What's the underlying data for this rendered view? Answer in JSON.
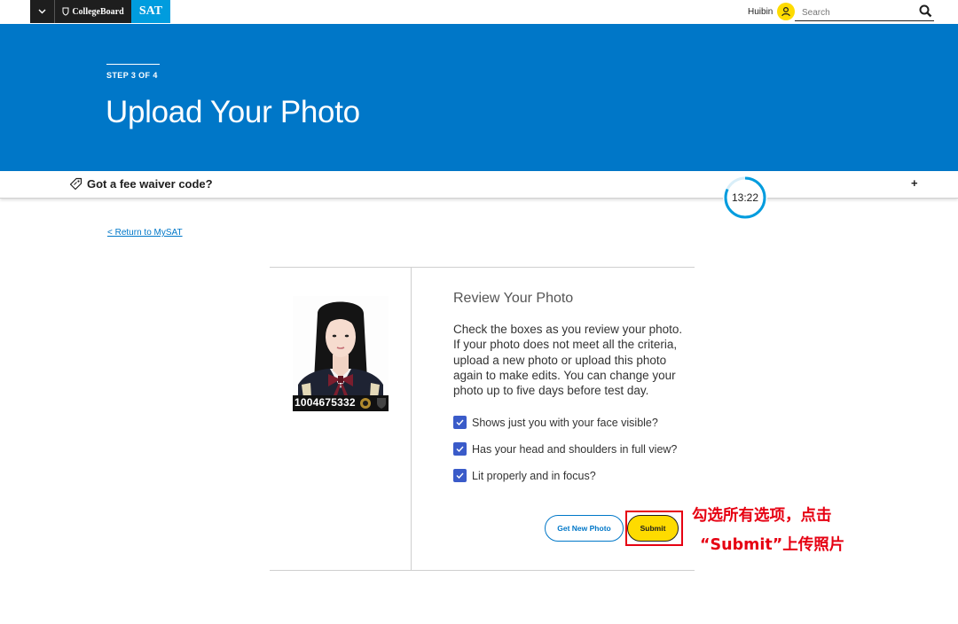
{
  "header": {
    "brand_collegeboard": "CollegeBoard",
    "brand_sat": "SAT",
    "user_name": "Huibin",
    "search_placeholder": "Search"
  },
  "hero": {
    "step": "STEP 3 OF 4",
    "title": "Upload Your Photo",
    "background_color": "#0077c8"
  },
  "fee_waiver": {
    "label": "Got a fee waiver code?",
    "toggle": "+"
  },
  "timer": {
    "time": "13:22",
    "remaining_fraction": 0.82
  },
  "return_link": "< Return to MySAT",
  "photo": {
    "id_number": "1004675332"
  },
  "review": {
    "title": "Review Your Photo",
    "instructions": "Check the boxes as you review your photo. If your photo does not meet all the criteria, upload a new photo or upload this photo again to make edits. You can change your photo up to five days before test day.",
    "checks": [
      {
        "label": "Shows just you with your face visible?",
        "checked": true
      },
      {
        "label": "Has your head and shoulders in full view?",
        "checked": true
      },
      {
        "label": "Lit properly and in focus?",
        "checked": true
      }
    ]
  },
  "buttons": {
    "new_photo": "Get New Photo",
    "submit": "Submit"
  },
  "annotation": {
    "line1": "勾选所有选项，点击",
    "line2": "“Submit”上传照片",
    "color": "#e60012"
  },
  "colors": {
    "accent_blue": "#0077c8",
    "sat_blue": "#009cde",
    "submit_yellow": "#fedb00",
    "checkbox_blue": "#3a5bc9"
  }
}
